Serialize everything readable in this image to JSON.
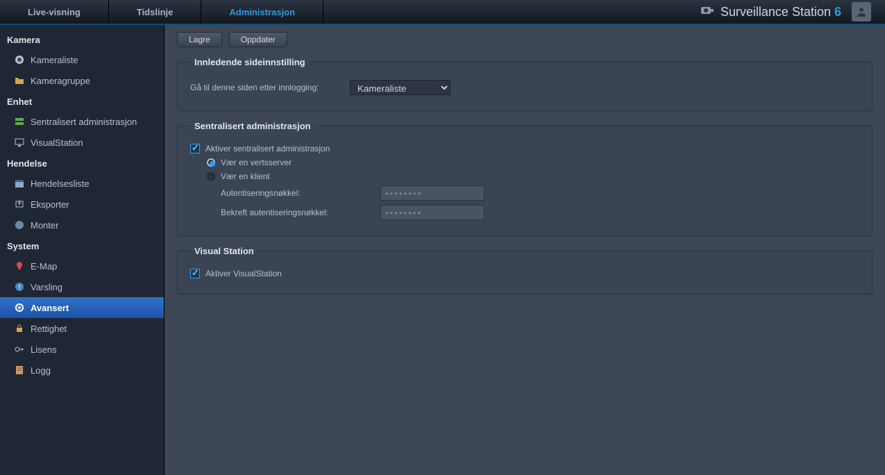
{
  "top": {
    "nav": [
      {
        "label": "Live-visning",
        "active": false
      },
      {
        "label": "Tidslinje",
        "active": false
      },
      {
        "label": "Administrasjon",
        "active": true
      }
    ],
    "brand": "Surveillance Station",
    "brand_num": "6"
  },
  "sidebar": {
    "groups": [
      {
        "title": "Kamera",
        "items": [
          {
            "label": "Kameraliste",
            "icon": "camera-icon"
          },
          {
            "label": "Kameragruppe",
            "icon": "folder-icon"
          }
        ]
      },
      {
        "title": "Enhet",
        "items": [
          {
            "label": "Sentralisert administrasjon",
            "icon": "server-icon"
          },
          {
            "label": "VisualStation",
            "icon": "monitor-icon"
          }
        ]
      },
      {
        "title": "Hendelse",
        "items": [
          {
            "label": "Hendelsesliste",
            "icon": "calendar-icon"
          },
          {
            "label": "Eksporter",
            "icon": "export-icon"
          },
          {
            "label": "Monter",
            "icon": "mount-icon"
          }
        ]
      },
      {
        "title": "System",
        "items": [
          {
            "label": "E-Map",
            "icon": "pin-icon"
          },
          {
            "label": "Varsling",
            "icon": "alert-icon"
          },
          {
            "label": "Avansert",
            "icon": "gear-icon",
            "selected": true
          },
          {
            "label": "Rettighet",
            "icon": "lock-icon"
          },
          {
            "label": "Lisens",
            "icon": "key-icon"
          },
          {
            "label": "Logg",
            "icon": "log-icon"
          }
        ]
      }
    ]
  },
  "toolbar": {
    "save": "Lagre",
    "update": "Oppdater"
  },
  "panel_initial": {
    "legend": "Innledende sideinnstilling",
    "goto_label": "Gå til denne siden etter innlogging:",
    "goto_value": "Kameraliste"
  },
  "panel_central": {
    "legend": "Sentralisert administrasjon",
    "enable_label": "Aktiver sentralisert administrasjon",
    "enable_checked": true,
    "host_label": "Vær en vertsserver",
    "host_selected": true,
    "client_label": "Vær en klient",
    "client_selected": false,
    "authkey_label": "Autentiseringsnøkkel:",
    "authkey_value": "••••••••",
    "confirm_label": "Bekreft autentiseringsnøkkel:",
    "confirm_value": "••••••••"
  },
  "panel_visual": {
    "legend": "Visual Station",
    "enable_label": "Aktiver VisualStation",
    "enable_checked": true
  }
}
